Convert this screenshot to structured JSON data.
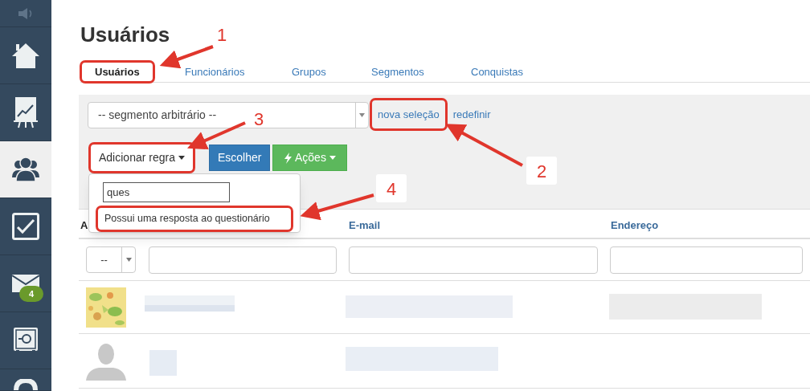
{
  "sidebar": {
    "items": [
      {
        "kind": "speaker",
        "selected": false
      },
      {
        "kind": "home",
        "selected": false
      },
      {
        "kind": "chart",
        "selected": false
      },
      {
        "kind": "users",
        "selected": true
      },
      {
        "kind": "tasks",
        "selected": false
      },
      {
        "kind": "mail",
        "selected": false,
        "badge": "4"
      },
      {
        "kind": "safe",
        "selected": false
      },
      {
        "kind": "help",
        "selected": false
      }
    ]
  },
  "page_title": "Usuários",
  "tabs": [
    {
      "label": "Usuários",
      "selected": true,
      "highlighted": true
    },
    {
      "label": "Funcionários",
      "selected": false,
      "highlighted": false
    },
    {
      "label": "Grupos",
      "selected": false,
      "highlighted": false
    },
    {
      "label": "Segmentos",
      "selected": false,
      "highlighted": false
    },
    {
      "label": "Conquistas",
      "selected": false,
      "highlighted": false
    }
  ],
  "segment_select": {
    "value": "-- segmento arbitrário --"
  },
  "links": [
    {
      "label": "nova seleção",
      "highlighted": true
    },
    {
      "label": "redefinir",
      "highlighted": false
    }
  ],
  "buttons": [
    {
      "label": "Adicionar regra",
      "kind": "dropdown",
      "highlighted": true
    },
    {
      "label": "Escolher",
      "kind": "primary",
      "highlighted": false
    },
    {
      "label": "Ações",
      "kind": "success",
      "highlighted": false
    }
  ],
  "rule_menu": {
    "search_value": "ques",
    "items": [
      {
        "label": "Possui uma resposta ao questionário",
        "highlighted": true
      }
    ]
  },
  "table": {
    "columns": [
      {
        "label": "A"
      },
      {
        "label": "E-mail"
      },
      {
        "label": "Endereço"
      }
    ],
    "filter_select": {
      "value": "--"
    },
    "rows": [
      {
        "kind": "picture"
      },
      {
        "kind": "silhouette"
      }
    ]
  },
  "callouts": [
    {
      "label": "1"
    },
    {
      "label": "2"
    },
    {
      "label": "3"
    },
    {
      "label": "4"
    }
  ]
}
